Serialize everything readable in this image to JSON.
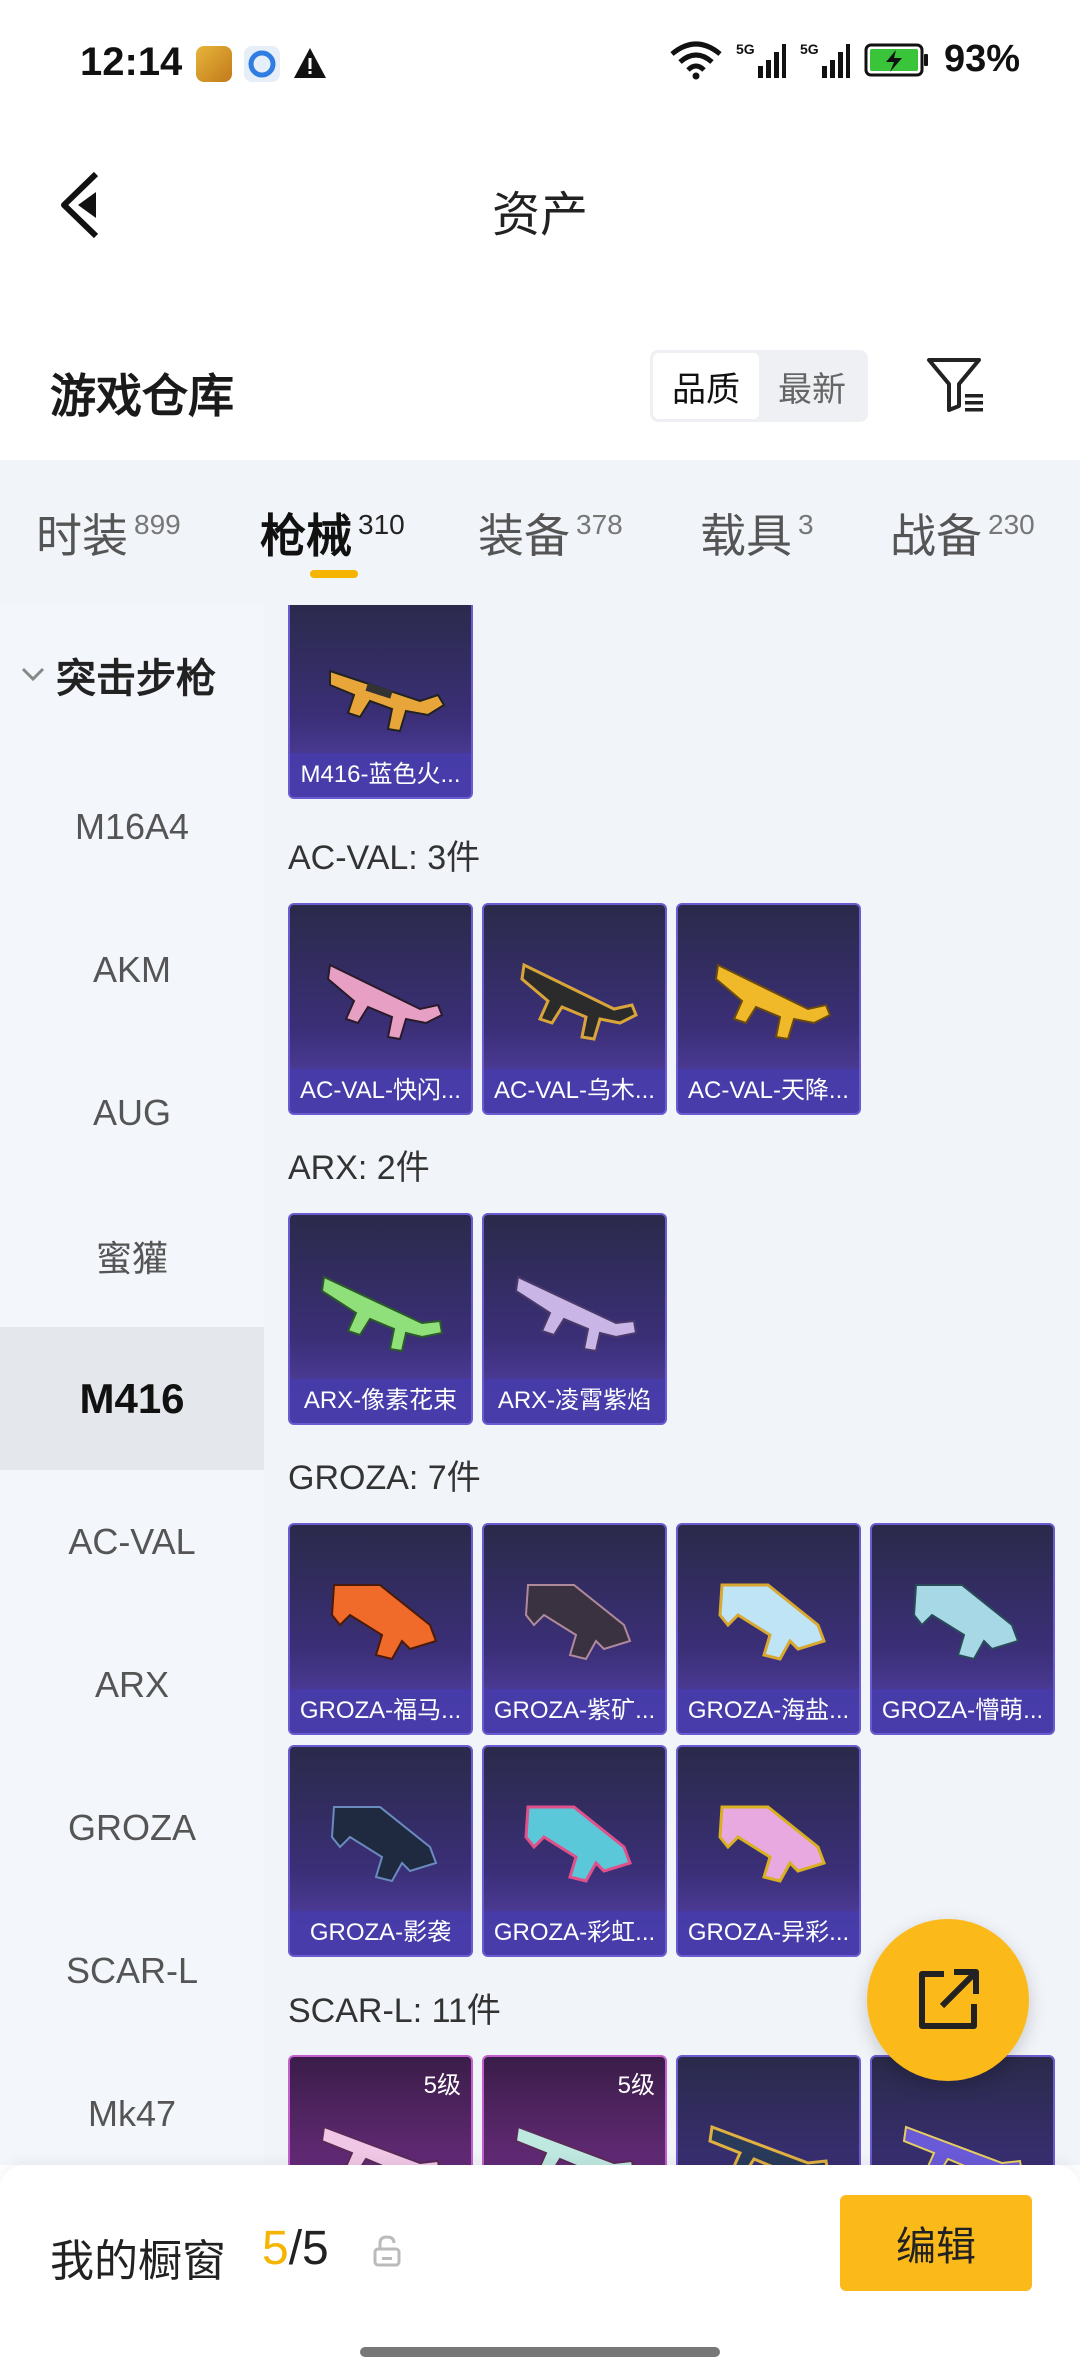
{
  "status_bar": {
    "time": "12:14",
    "battery": "93%",
    "icons": [
      "app-icon",
      "browser-icon",
      "warning-icon",
      "wifi-icon",
      "signal-5g-icon",
      "signal-5g-icon",
      "battery-charging-icon"
    ]
  },
  "header": {
    "title": "资产",
    "back_icon": "back-arrow-icon"
  },
  "warehouse": {
    "title": "游戏仓库",
    "sort_options": [
      "品质",
      "最新"
    ],
    "active_sort": "品质",
    "filter_icon": "filter-icon"
  },
  "tabs": [
    {
      "label": "时装",
      "count": "899"
    },
    {
      "label": "枪械",
      "count": "310"
    },
    {
      "label": "装备",
      "count": "378"
    },
    {
      "label": "载具",
      "count": "3"
    },
    {
      "label": "战备",
      "count": "230"
    }
  ],
  "active_tab": "枪械",
  "sidebar": {
    "group": "突击步枪",
    "items": [
      "M16A4",
      "AKM",
      "AUG",
      "蜜獾",
      "M416",
      "AC-VAL",
      "ARX",
      "GROZA",
      "SCAR-L",
      "Mk47"
    ],
    "active": "M416"
  },
  "content": {
    "top_item": "M416-蓝色火...",
    "sections": [
      {
        "title": "AC-VAL: 3件",
        "items": [
          "AC-VAL-快闪...",
          "AC-VAL-乌木...",
          "AC-VAL-天降..."
        ]
      },
      {
        "title": "ARX: 2件",
        "items": [
          "ARX-像素花束",
          "ARX-凌霄紫焰"
        ]
      },
      {
        "title": "GROZA: 7件",
        "items": [
          "GROZA-福马...",
          "GROZA-紫矿...",
          "GROZA-海盐...",
          "GROZA-懵萌...",
          "GROZA-影袭",
          "GROZA-彩虹...",
          "GROZA-异彩..."
        ]
      },
      {
        "title": "SCAR-L: 11件",
        "badges": [
          "5级",
          "5级"
        ]
      }
    ]
  },
  "colors": {
    "accent": "#fbb91a",
    "card_blue": "#3b2f78",
    "card_purple": "#6a2c7e"
  },
  "bottom": {
    "showcase_label": "我的橱窗",
    "used": "5",
    "separator": "/",
    "total": "5",
    "edit_label": "编辑"
  }
}
